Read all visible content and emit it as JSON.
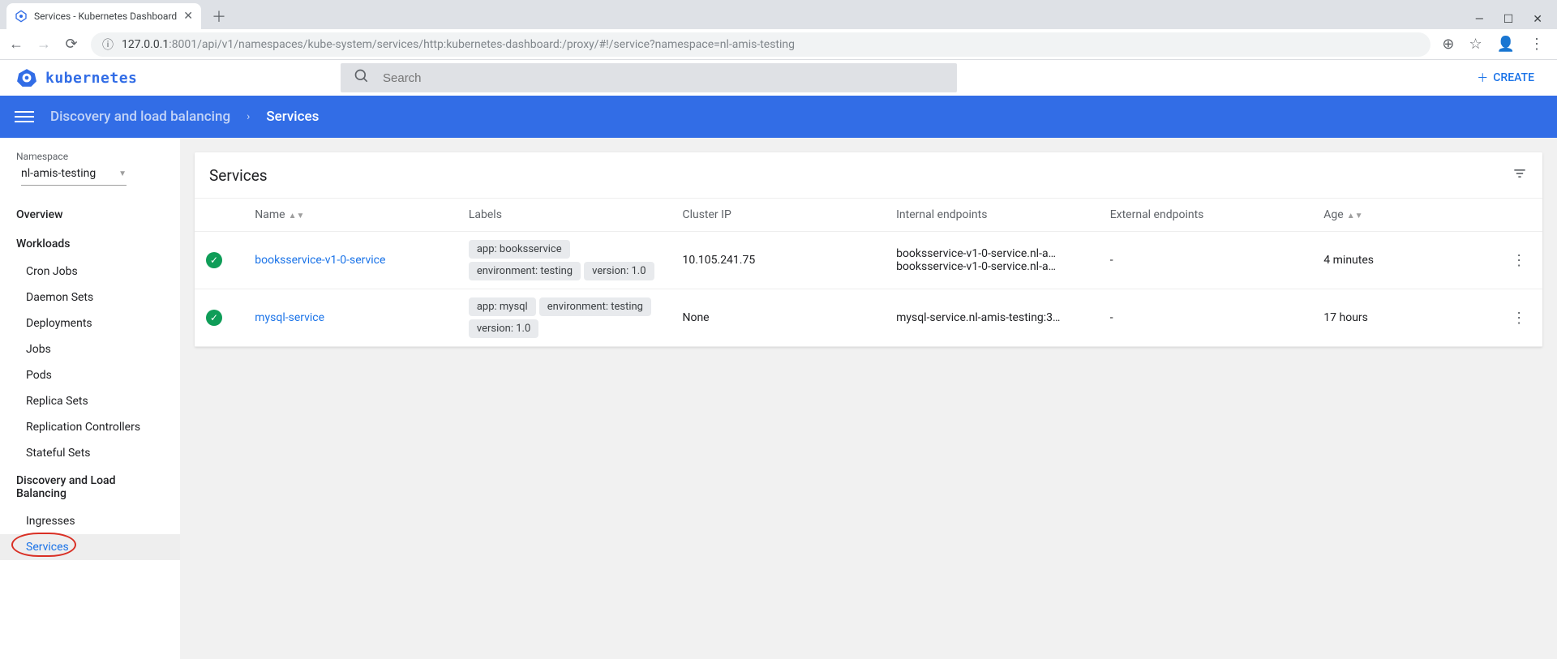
{
  "browser": {
    "tab_title": "Services - Kubernetes Dashboard",
    "url_prefix": "127.0.0.1",
    "url_suffix": ":8001/api/v1/namespaces/kube-system/services/http:kubernetes-dashboard:/proxy/#!/service?namespace=nl-amis-testing"
  },
  "app": {
    "logo": "kubernetes",
    "search_placeholder": "Search",
    "create_label": "CREATE"
  },
  "breadcrumb": {
    "section": "Discovery and load balancing",
    "current": "Services"
  },
  "sidebar": {
    "namespace_label": "Namespace",
    "namespace_value": "nl-amis-testing",
    "overview": "Overview",
    "workloads_header": "Workloads",
    "workloads": [
      "Cron Jobs",
      "Daemon Sets",
      "Deployments",
      "Jobs",
      "Pods",
      "Replica Sets",
      "Replication Controllers",
      "Stateful Sets"
    ],
    "dlb_header": "Discovery and Load Balancing",
    "dlb": [
      "Ingresses",
      "Services"
    ]
  },
  "card": {
    "title": "Services",
    "columns": {
      "name": "Name",
      "labels": "Labels",
      "cluster_ip": "Cluster IP",
      "internal_endpoints": "Internal endpoints",
      "external_endpoints": "External endpoints",
      "age": "Age"
    },
    "rows": [
      {
        "name": "booksservice-v1-0-service",
        "labels": [
          "app: booksservice",
          "environment: testing",
          "version: 1.0"
        ],
        "cluster_ip": "10.105.241.75",
        "internal_endpoints": [
          "booksservice-v1-0-service.nl-a…",
          "booksservice-v1-0-service.nl-a…"
        ],
        "external_endpoints": "-",
        "age": "4 minutes"
      },
      {
        "name": "mysql-service",
        "labels": [
          "app: mysql",
          "environment: testing",
          "version: 1.0"
        ],
        "cluster_ip": "None",
        "internal_endpoints": [
          "mysql-service.nl-amis-testing:3…"
        ],
        "external_endpoints": "-",
        "age": "17 hours"
      }
    ]
  }
}
